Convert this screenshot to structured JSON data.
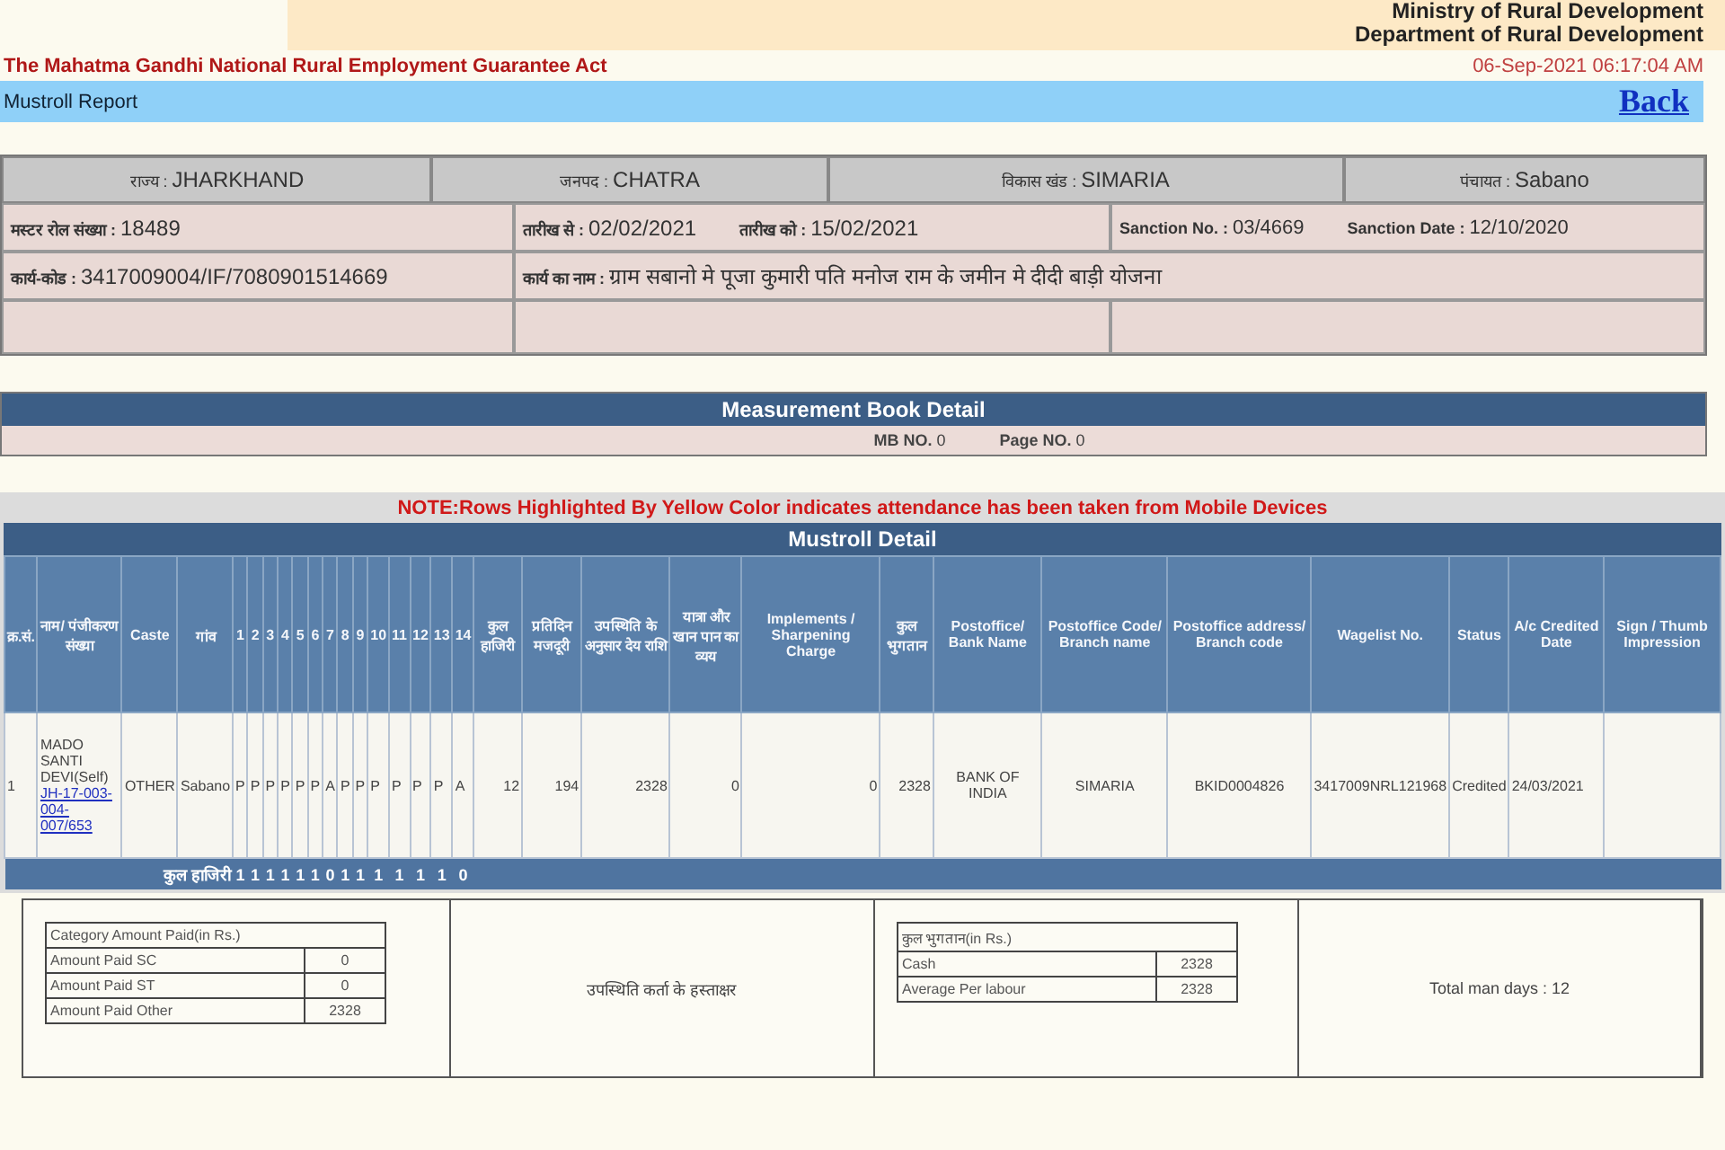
{
  "header": {
    "ministry": "Ministry of Rural Development",
    "department": "Department of Rural Development",
    "act": "The Mahatma Gandhi National Rural Employment Guarantee Act",
    "timestamp": "06-Sep-2021 06:17:04 AM"
  },
  "report_bar": {
    "title": "Mustroll Report",
    "back_link": "Back"
  },
  "location": [
    {
      "label": "राज्य :",
      "value": "JHARKHAND"
    },
    {
      "label": "जनपद :",
      "value": "CHATRA"
    },
    {
      "label": "विकास खंड :",
      "value": "SIMARIA"
    },
    {
      "label": "पंचायत :",
      "value": "Sabano"
    }
  ],
  "details": {
    "muster_roll_no": {
      "label": "मस्टर रोल संख्या :",
      "value": "18489"
    },
    "date_from": {
      "label": "तारीख से :",
      "value": "02/02/2021"
    },
    "date_to": {
      "label": "तारीख को :",
      "value": "15/02/2021"
    },
    "sanction_no": {
      "label": "Sanction No. :",
      "value": "03/4669"
    },
    "sanction_date": {
      "label": "Sanction Date :",
      "value": "12/10/2020"
    },
    "work_code": {
      "label": "कार्य-कोड :",
      "value": "3417009004/IF/7080901514669"
    },
    "work_name": {
      "label": "कार्य का नाम :",
      "value": "ग्राम सबानो मे पूजा कुमारी पति मनोज राम के जमीन मे दीदी बाड़ी योजना"
    }
  },
  "measurement_book": {
    "title": "Measurement Book Detail",
    "fields": [
      {
        "label": "MB NO.",
        "value": "0"
      },
      {
        "label": "Page NO.",
        "value": "0"
      }
    ]
  },
  "note": "NOTE:Rows Highlighted By Yellow Color indicates attendance has been taken from Mobile Devices",
  "mustroll": {
    "title": "Mustroll Detail",
    "columns": [
      "क्र.सं.",
      "नाम/ पंजीकरण संख्या",
      "Caste",
      "गांव",
      "1",
      "2",
      "3",
      "4",
      "5",
      "6",
      "7",
      "8",
      "9",
      "10",
      "11",
      "12",
      "13",
      "14",
      "कुल हाजिरी",
      "प्रतिदिन मजदूरी",
      "उपस्थिति के अनुसार देय राशि",
      "यात्रा और खान पान का व्यय",
      "Implements / Sharpening Charge",
      "कुल भुगतान",
      "Postoffice/ Bank Name",
      "Postoffice Code/ Branch name",
      "Postoffice address/ Branch code",
      "Wagelist No.",
      "Status",
      "A/c Credited Date",
      "Sign / Thumb Impression"
    ],
    "rows": [
      {
        "serial": "1",
        "name": "MADO SANTI DEVI(Self)",
        "registration": "JH-17-003-004-007/653",
        "caste": "OTHER",
        "village": "Sabano",
        "attendance": [
          "P",
          "P",
          "P",
          "P",
          "P",
          "P",
          "A",
          "P",
          "P",
          "P",
          "P",
          "P",
          "P",
          "A"
        ],
        "values": [
          "12",
          "194",
          "2328",
          "0",
          "0",
          "2328",
          "BANK OF INDIA",
          "SIMARIA",
          "BKID0004826",
          "3417009NRL121968",
          "Credited",
          "24/03/2021"
        ]
      }
    ],
    "total_row": {
      "label": "कुल हाजिरी",
      "values": [
        "1",
        "1",
        "1",
        "1",
        "1",
        "1",
        "0",
        "1",
        "1",
        "1",
        "1",
        "1",
        "1",
        "0"
      ]
    }
  },
  "summary": {
    "category_table": {
      "title": "Category Amount Paid(in Rs.)",
      "rows": [
        {
          "label": "Amount Paid SC",
          "value": "0"
        },
        {
          "label": "Amount Paid ST",
          "value": "0"
        },
        {
          "label": "Amount Paid Other",
          "value": "2328"
        }
      ]
    },
    "signature_label": "उपस्थिति कर्ता के हस्ताक्षर",
    "payment_table": {
      "title": "कुल भुगतान(in Rs.)",
      "rows": [
        {
          "label": "Cash",
          "value": "2328"
        },
        {
          "label": "Average Per labour",
          "value": "2328"
        }
      ]
    },
    "total_man_days": "Total man days : 12"
  }
}
